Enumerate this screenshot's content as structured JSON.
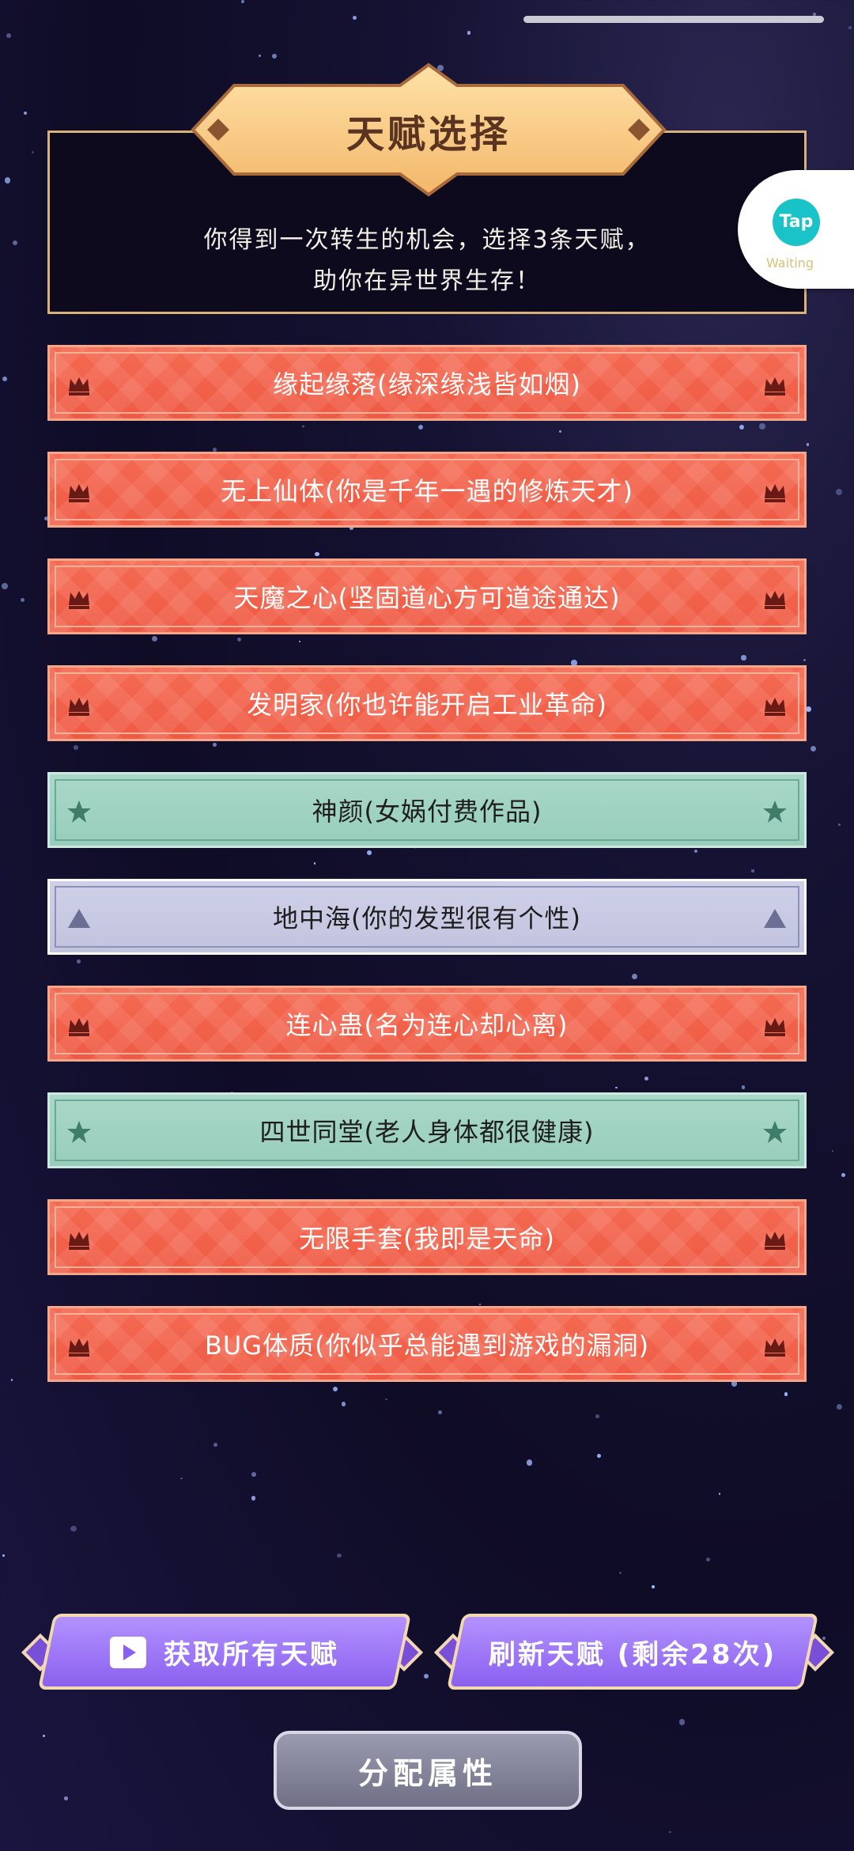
{
  "header": {
    "title": "天赋选择",
    "subtitle_line1": "你得到一次转生的机会，选择3条天赋，",
    "subtitle_line2": "助你在异世界生存！"
  },
  "tap_widget": {
    "logo_text": "Tap",
    "status": "Waiting"
  },
  "talents": [
    {
      "label": "缘起缘落(缘深缘浅皆如烟)",
      "rank": "red",
      "icon": "crown-icon"
    },
    {
      "label": "无上仙体(你是千年一遇的修炼天才)",
      "rank": "red",
      "icon": "crown-icon"
    },
    {
      "label": "天魔之心(坚固道心方可道途通达)",
      "rank": "red",
      "icon": "crown-icon"
    },
    {
      "label": "发明家(你也许能开启工业革命)",
      "rank": "red",
      "icon": "crown-icon"
    },
    {
      "label": "神颜(女娲付费作品)",
      "rank": "teal",
      "icon": "star-icon"
    },
    {
      "label": "地中海(你的发型很有个性)",
      "rank": "gray",
      "icon": "triangle-icon"
    },
    {
      "label": "连心蛊(名为连心却心离)",
      "rank": "red",
      "icon": "crown-icon"
    },
    {
      "label": "四世同堂(老人身体都很健康)",
      "rank": "teal",
      "icon": "star-icon"
    },
    {
      "label": "无限手套(我即是天命)",
      "rank": "red",
      "icon": "crown-icon"
    },
    {
      "label": "BUG体质(你似乎总能遇到游戏的漏洞)",
      "rank": "red",
      "icon": "crown-icon"
    }
  ],
  "buttons": {
    "get_all": "获取所有天赋",
    "refresh": "刷新天赋 (剩余28次)",
    "allocate": "分配属性"
  },
  "colors": {
    "red_rank": "#f4644d",
    "teal_rank": "#a2d4c4",
    "gray_rank": "#c8c9e2",
    "button_purple": "#9a74f5",
    "gold_border": "#d9b27a"
  }
}
